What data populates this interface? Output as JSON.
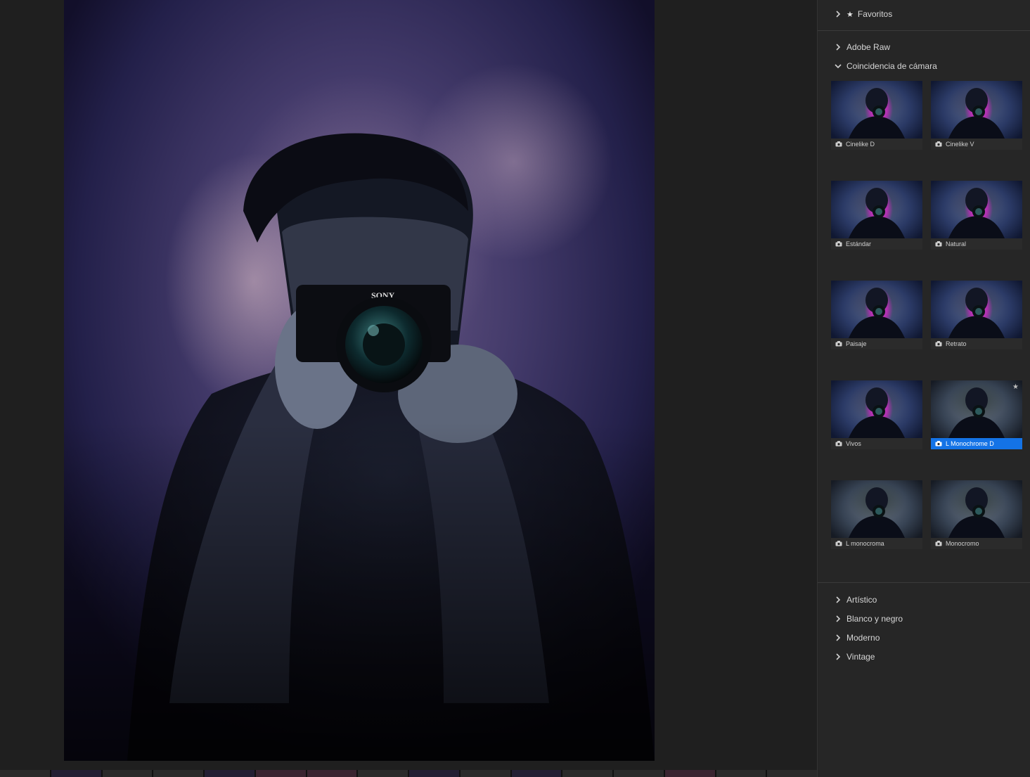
{
  "panel": {
    "favorites_label": "Favoritos",
    "adobe_raw_label": "Adobe Raw",
    "camera_match_label": "Coincidencia de cámara",
    "profiles": [
      {
        "name": "Cinelike D",
        "style": "color"
      },
      {
        "name": "Cinelike V",
        "style": "color"
      },
      {
        "name": "Estándar",
        "style": "color"
      },
      {
        "name": "Natural",
        "style": "color"
      },
      {
        "name": "Paisaje",
        "style": "color"
      },
      {
        "name": "Retrato",
        "style": "color"
      },
      {
        "name": "Vivos",
        "style": "color"
      },
      {
        "name": "L Monochrome D",
        "style": "mono",
        "selected": true,
        "favorite": true
      },
      {
        "name": "L monocroma",
        "style": "mono"
      },
      {
        "name": "Monocromo",
        "style": "mono"
      }
    ],
    "groups": [
      "Artístico",
      "Blanco y negro",
      "Moderno",
      "Vintage"
    ]
  },
  "photo": {
    "camera_brand": "SONY"
  },
  "colors": {
    "accent": "#1473e6",
    "panel_bg": "#262626"
  }
}
